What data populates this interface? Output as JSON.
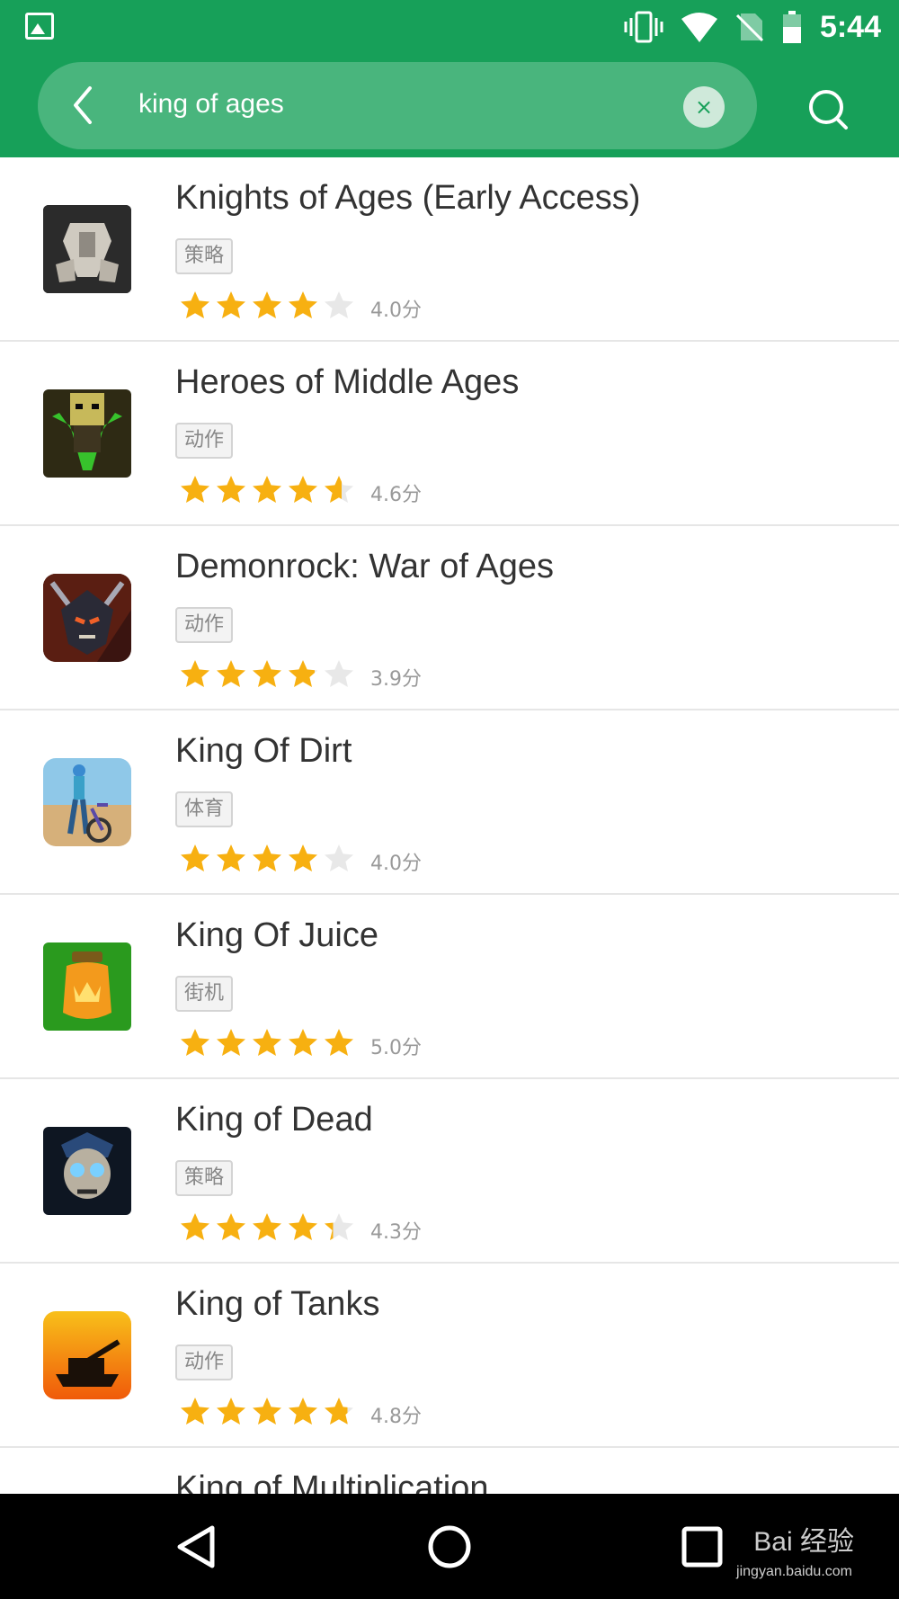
{
  "status_bar": {
    "time": "5:44",
    "icons": [
      "image-icon",
      "vibrate-icon",
      "wifi-icon",
      "no-sim-icon",
      "battery-icon"
    ]
  },
  "search": {
    "query": "king of ages",
    "clear_symbol": "×"
  },
  "colors": {
    "brand_green": "#17a059",
    "star_active": "#f7b011",
    "star_inactive": "#e8e8e8"
  },
  "apps": [
    {
      "name": "Knights of Ages (Early Access)",
      "tag": "策略",
      "rating": 4.0,
      "score": "4.0分",
      "icon": "armor-icon"
    },
    {
      "name": "Heroes of Middle Ages",
      "tag": "动作",
      "rating": 4.6,
      "score": "4.6分",
      "icon": "hero-icon"
    },
    {
      "name": "Demonrock: War of Ages",
      "tag": "动作",
      "rating": 3.9,
      "score": "3.9分",
      "icon": "demon-icon"
    },
    {
      "name": "King Of Dirt",
      "tag": "体育",
      "rating": 4.0,
      "score": "4.0分",
      "icon": "bike-icon"
    },
    {
      "name": "King Of Juice",
      "tag": "街机",
      "rating": 5.0,
      "score": "5.0分",
      "icon": "juice-jar-icon"
    },
    {
      "name": "King of Dead",
      "tag": "策略",
      "rating": 4.3,
      "score": "4.3分",
      "icon": "skull-icon"
    },
    {
      "name": "King of Tanks",
      "tag": "动作",
      "rating": 4.8,
      "score": "4.8分",
      "icon": "tank-icon"
    },
    {
      "name": "King of Multiplication",
      "tag": "",
      "rating": 0,
      "score": "",
      "icon": ""
    }
  ],
  "watermark": {
    "main": "Bai 经验",
    "sub": "jingyan.baidu.com"
  }
}
